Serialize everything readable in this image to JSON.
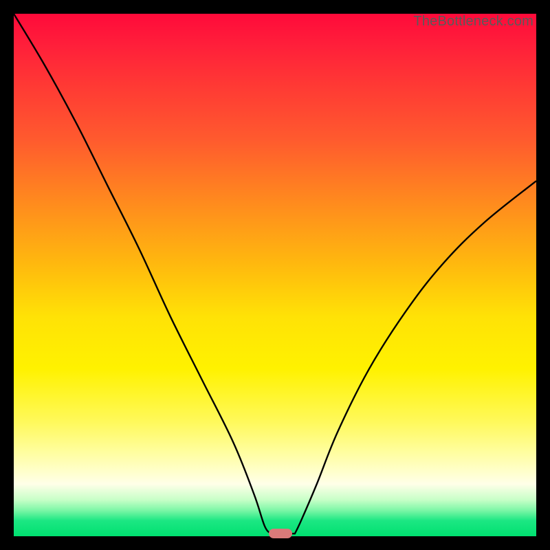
{
  "watermark": "TheBottleneck.com",
  "chart_data": {
    "type": "line",
    "title": "",
    "xlabel": "",
    "ylabel": "",
    "xlim": [
      0,
      100
    ],
    "ylim": [
      0,
      100
    ],
    "grid": false,
    "legend": false,
    "background_gradient": {
      "top": "#ff0a3a",
      "mid_upper": "#ff8a1e",
      "mid": "#fff200",
      "lower": "#ffffe8",
      "bottom": "#00e070"
    },
    "series": [
      {
        "name": "bottleneck-curve-left",
        "x": [
          0,
          6,
          12,
          18,
          24,
          30,
          36,
          42,
          46,
          48,
          49.2
        ],
        "values": [
          100,
          90,
          79,
          67,
          55,
          42,
          30,
          18,
          8,
          2,
          0.5
        ]
      },
      {
        "name": "bottleneck-curve-right",
        "x": [
          53.8,
          55,
          58,
          62,
          68,
          75,
          82,
          90,
          100
        ],
        "values": [
          0.5,
          3,
          10,
          20,
          32,
          43,
          52,
          60,
          68
        ]
      }
    ],
    "flat_segment": {
      "x_start": 49.2,
      "x_end": 53.8,
      "value": 0.5
    },
    "marker": {
      "x": 51,
      "y": 0.5,
      "color": "#d97a7a"
    }
  }
}
